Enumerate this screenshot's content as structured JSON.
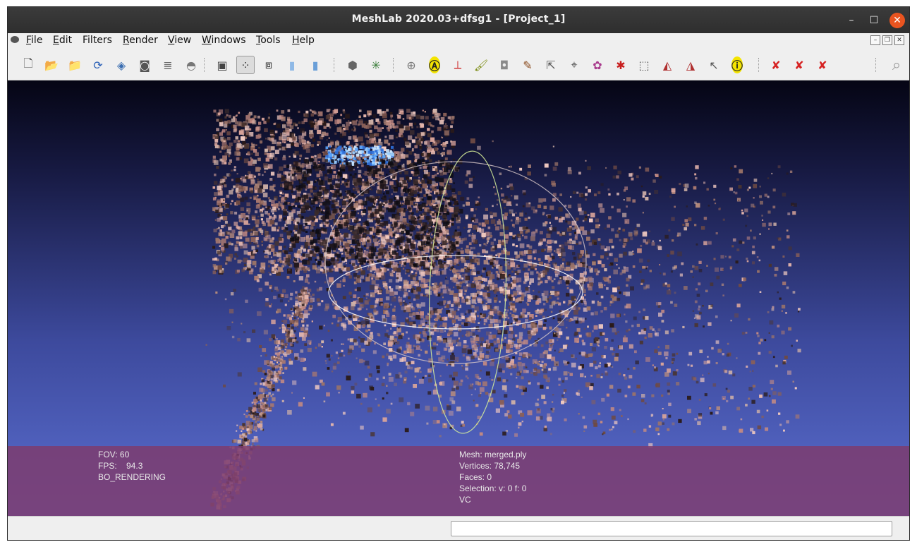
{
  "window": {
    "title": "MeshLab 2020.03+dfsg1 - [Project_1]"
  },
  "controls": {
    "minimize": "–",
    "maximize": "☐",
    "close": "✕"
  },
  "menu": [
    {
      "label": "File",
      "u": "F",
      "rest": "ile"
    },
    {
      "label": "Edit",
      "u": "E",
      "rest": "dit"
    },
    {
      "label": "Filters",
      "u": "",
      "rest": "Filters"
    },
    {
      "label": "Render",
      "u": "R",
      "rest": "ender"
    },
    {
      "label": "View",
      "u": "V",
      "rest": "iew"
    },
    {
      "label": "Windows",
      "u": "W",
      "rest": "indows"
    },
    {
      "label": "Tools",
      "u": "T",
      "rest": "ools"
    },
    {
      "label": "Help",
      "u": "H",
      "rest": "elp"
    }
  ],
  "mdi": {
    "minimize": "–",
    "restore": "❐",
    "close": "✕"
  },
  "toolbar": [
    {
      "name": "new-project-icon",
      "glyph": "🗋",
      "color": "#444444"
    },
    {
      "name": "open-project-icon",
      "glyph": "📂",
      "color": "#c8a100"
    },
    {
      "name": "import-mesh-icon",
      "glyph": "📁",
      "color": "#c8a100"
    },
    {
      "name": "reload-icon",
      "glyph": "⟳",
      "color": "#2c61b7"
    },
    {
      "name": "export-mesh-icon",
      "glyph": "◈",
      "color": "#3a6db0"
    },
    {
      "name": "snapshot-icon",
      "glyph": "◙",
      "color": "#555555"
    },
    {
      "name": "layers-icon",
      "glyph": "≣",
      "color": "#6a6a6a"
    },
    {
      "name": "raster-layer-icon",
      "glyph": "◓",
      "color": "#777777"
    },
    {
      "name": "bounding-box-icon",
      "glyph": "▣",
      "color": "#444444"
    },
    {
      "name": "points-render-icon",
      "glyph": "⁘",
      "color": "#333333"
    },
    {
      "name": "wireframe-render-icon",
      "glyph": "⧈",
      "color": "#333333"
    },
    {
      "name": "flat-render-icon",
      "glyph": "▮",
      "color": "#8fb9e6"
    },
    {
      "name": "smooth-render-icon",
      "glyph": "▮",
      "color": "#6a9fd8"
    },
    {
      "name": "lighting-icon",
      "glyph": "⬢",
      "color": "#666666"
    },
    {
      "name": "trackball-axes-icon",
      "glyph": "✳",
      "color": "#3a7d3a"
    },
    {
      "name": "sphere-icon",
      "glyph": "⊕",
      "color": "#777777"
    },
    {
      "name": "annotation-icon",
      "glyph": "Ⓐ",
      "color": "#222222"
    },
    {
      "name": "measure-axes-icon",
      "glyph": "⟂",
      "color": "#d13a3a"
    },
    {
      "name": "paint-bucket-icon",
      "glyph": "🖌",
      "color": "#7a8a10"
    },
    {
      "name": "raster-align-icon",
      "glyph": "◘",
      "color": "#8a8a8a"
    },
    {
      "name": "brush-icon",
      "glyph": "✎",
      "color": "#8a4b1e"
    },
    {
      "name": "select-vertex-icon",
      "glyph": "⇱",
      "color": "#555555"
    },
    {
      "name": "pick-points-icon",
      "glyph": "⌖",
      "color": "#444444"
    },
    {
      "name": "texture-paint-icon",
      "glyph": "✿",
      "color": "#a83a8c"
    },
    {
      "name": "georef-icon",
      "glyph": "✱",
      "color": "#c81e1e"
    },
    {
      "name": "select-rect-icon",
      "glyph": "⬚",
      "color": "#555555"
    },
    {
      "name": "select-faces-icon",
      "glyph": "◭",
      "color": "#b03030"
    },
    {
      "name": "select-connected-icon",
      "glyph": "◮",
      "color": "#b03030"
    },
    {
      "name": "select-pointer-icon",
      "glyph": "↖",
      "color": "#555555"
    },
    {
      "name": "info-icon",
      "glyph": "ⓘ",
      "color": "#222222"
    },
    {
      "name": "delete-vertices-icon",
      "glyph": "✘",
      "color": "#d62222"
    },
    {
      "name": "delete-faces-icon",
      "glyph": "✘",
      "color": "#d62222"
    },
    {
      "name": "delete-selection-icon",
      "glyph": "✘",
      "color": "#d62222"
    },
    {
      "name": "search-icon",
      "glyph": "⌕",
      "color": "#9a9a9a"
    }
  ],
  "info_left": [
    "FOV: 60",
    "FPS:    94.3",
    "BO_RENDERING"
  ],
  "info_right": [
    "Mesh: merged.ply",
    "Vertices: 78,745",
    "Faces: 0",
    "Selection: v: 0 f: 0",
    "VC"
  ]
}
